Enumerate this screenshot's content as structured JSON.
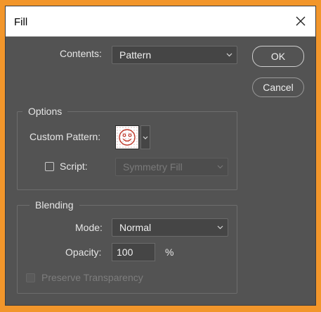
{
  "dialog": {
    "title": "Fill"
  },
  "contents": {
    "label": "Contents:",
    "value": "Pattern"
  },
  "buttons": {
    "ok": "OK",
    "cancel": "Cancel"
  },
  "options": {
    "legend": "Options",
    "custom_pattern_label": "Custom Pattern:",
    "script_label": "Script:",
    "script_value": "Symmetry Fill",
    "script_checked": false
  },
  "blending": {
    "legend": "Blending",
    "mode_label": "Mode:",
    "mode_value": "Normal",
    "opacity_label": "Opacity:",
    "opacity_value": "100",
    "opacity_unit": "%",
    "preserve_label": "Preserve Transparency",
    "preserve_checked": false
  },
  "icons": {
    "close": "close-icon",
    "dropdown": "chevron-down-icon",
    "pattern": "smiley-pattern-icon"
  },
  "colors": {
    "frame_accent": "#f2962b",
    "dialog_bg": "#535353",
    "titlebar_bg": "#ffffff",
    "pattern_stroke": "#c0392b"
  }
}
